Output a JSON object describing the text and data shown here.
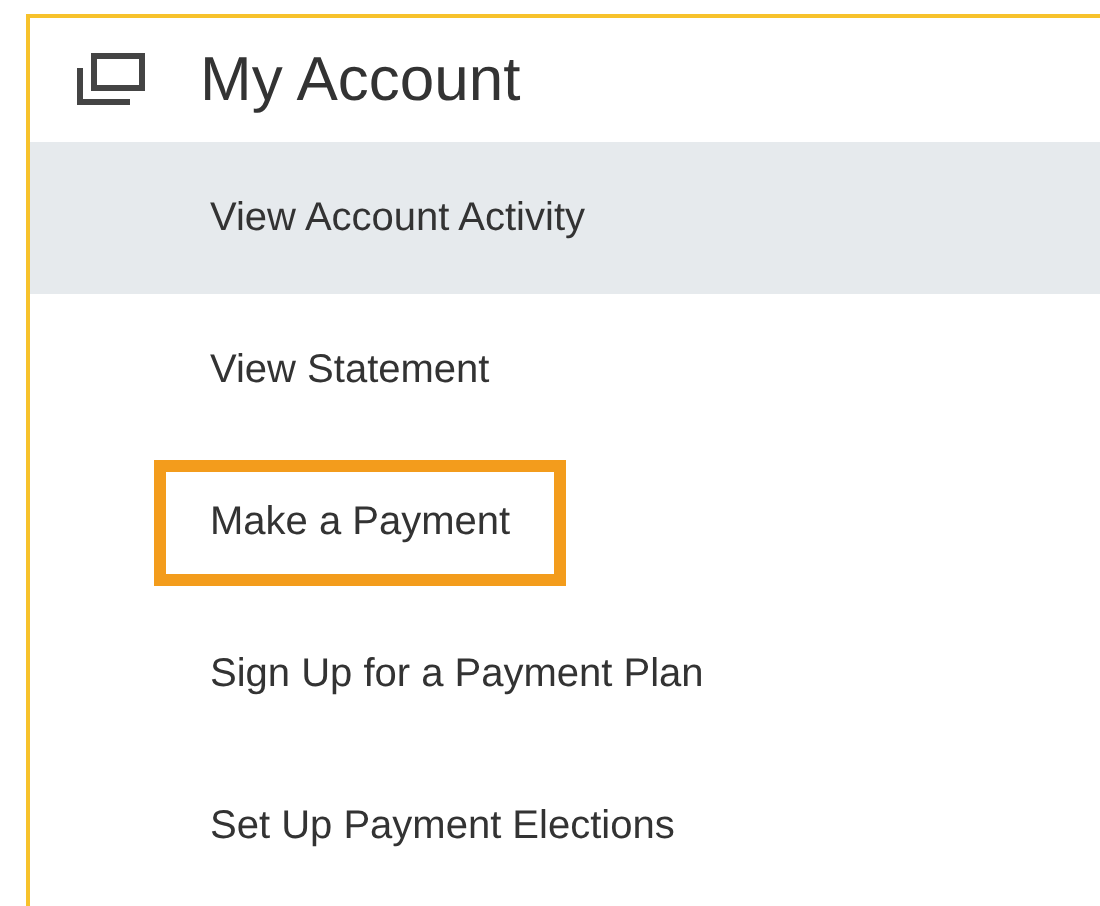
{
  "panel": {
    "title": "My Account"
  },
  "items": [
    {
      "label": "View Account Activity",
      "selected": true,
      "highlighted": false
    },
    {
      "label": "View Statement",
      "selected": false,
      "highlighted": false
    },
    {
      "label": "Make a Payment",
      "selected": false,
      "highlighted": true
    },
    {
      "label": "Sign Up for a Payment Plan",
      "selected": false,
      "highlighted": false
    },
    {
      "label": "Set Up Payment Elections",
      "selected": false,
      "highlighted": false
    }
  ]
}
